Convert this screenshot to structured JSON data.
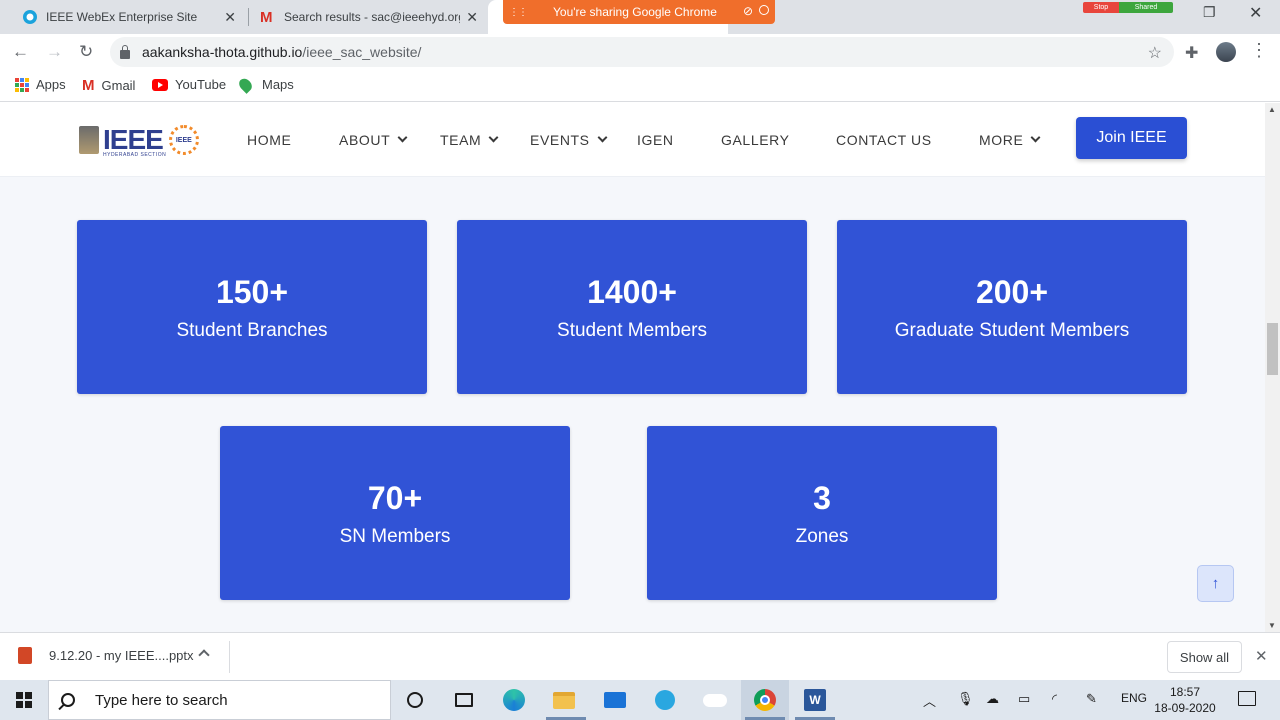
{
  "browser": {
    "tabs": [
      {
        "title": "IEEE WebEx Enterprise Site"
      },
      {
        "title": "Search results - sac@ieeehyd.org"
      }
    ],
    "sharing_banner": "You're sharing Google Chrome",
    "webex_controls": {
      "stop": "Stop",
      "shared": "Shared"
    },
    "url": {
      "host": "aakanksha-thota.github.io",
      "path": "/ieee_sac_website/"
    },
    "bookmarks": [
      {
        "label": "Apps",
        "icon": "apps-grid-icon"
      },
      {
        "label": "Gmail",
        "icon": "gmail-icon"
      },
      {
        "label": "YouTube",
        "icon": "youtube-icon"
      },
      {
        "label": "Maps",
        "icon": "maps-icon"
      }
    ]
  },
  "site": {
    "logo": {
      "text": "IEEE",
      "subtitle": "HYDERABAD SECTION",
      "badge": "IEEE"
    },
    "nav": [
      {
        "label": "HOME",
        "dropdown": false
      },
      {
        "label": "ABOUT",
        "dropdown": true
      },
      {
        "label": "TEAM",
        "dropdown": true
      },
      {
        "label": "EVENTS",
        "dropdown": true
      },
      {
        "label": "IGEN",
        "dropdown": false
      },
      {
        "label": "GALLERY",
        "dropdown": false
      },
      {
        "label": "CONTACT US",
        "dropdown": false
      },
      {
        "label": "MORE",
        "dropdown": true
      }
    ],
    "join_button": "Join IEEE",
    "stats": [
      {
        "value": "150+",
        "label": "Student Branches"
      },
      {
        "value": "1400+",
        "label": "Student Members"
      },
      {
        "value": "200+",
        "label": "Graduate Student Members"
      },
      {
        "value": "70+",
        "label": "SN Members"
      },
      {
        "value": "3",
        "label": "Zones"
      }
    ],
    "colors": {
      "card": "#3153d6",
      "button": "#2a4fd4",
      "page_bg": "#f5f7fb"
    }
  },
  "downloads": {
    "file": "9.12.20 - my IEEE....pptx",
    "show_all": "Show all"
  },
  "taskbar": {
    "search_placeholder": "Type here to search",
    "language": "ENG",
    "time": "18:57",
    "date": "18-09-2020"
  }
}
